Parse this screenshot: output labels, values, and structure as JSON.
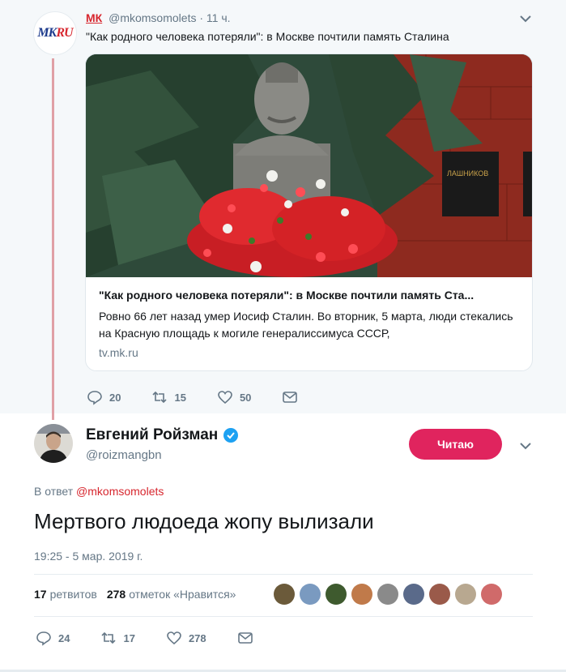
{
  "parent_tweet": {
    "avatar_logo": "MKRU",
    "name": "МК",
    "handle": "@mkomsomolets",
    "time": "· 11 ч.",
    "text": "\"Как родного человека потеряли\": в Москве почтили память Сталина",
    "card": {
      "title": "\"Как родного человека потеряли\": в Москве почтили память Ста...",
      "description": "Ровно 66 лет назад умер Иосиф Сталин. Во вторник, 5 марта, люди стекались на Красную площадь к могиле генералиссимуса СССР,",
      "url": "tv.mk.ru",
      "plaque_text": "ЛАШНИКОВ"
    },
    "actions": {
      "replies": "20",
      "retweets": "15",
      "likes": "50"
    }
  },
  "main_tweet": {
    "name": "Евгений Ройзман",
    "handle": "@roizmangbn",
    "follow_label": "Читаю",
    "reply_prefix": "В ответ",
    "reply_handle": "@mkomsomolets",
    "text": "Мертвого людоеда жопу вылизали",
    "timestamp": "19:25 - 5 мар. 2019 г.",
    "stats": {
      "retweets_count": "17",
      "retweets_label": "ретвитов",
      "likes_count": "278",
      "likes_label": "отметок «Нравится»"
    },
    "actions": {
      "replies": "24",
      "retweets": "17",
      "likes": "278"
    }
  },
  "colors": {
    "accent": "#e0245e",
    "link": "#d7262e",
    "muted": "#657786",
    "verified": "#1da1f2"
  },
  "icons": [
    "reply-icon",
    "retweet-icon",
    "heart-icon",
    "message-icon",
    "chevron-down-icon",
    "verified-badge-icon"
  ]
}
